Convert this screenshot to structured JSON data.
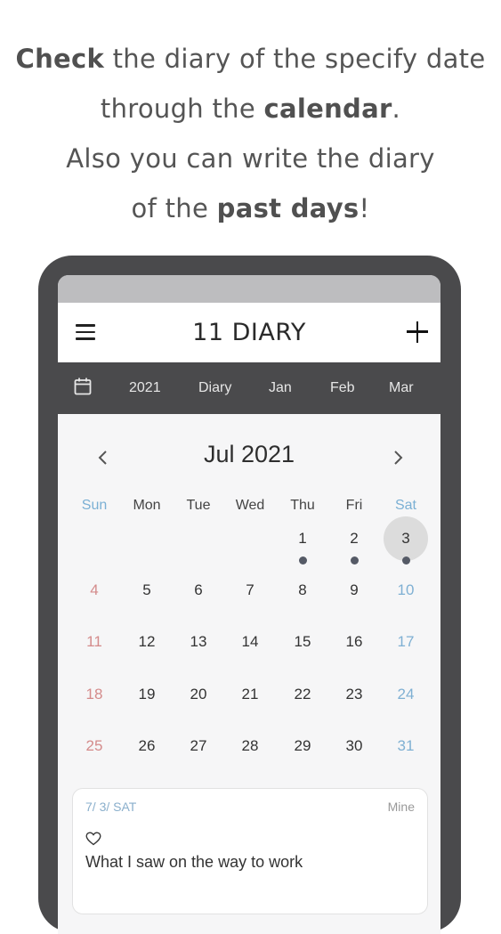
{
  "headline": {
    "line1_bold": "Check",
    "line1_rest": " the diary of the specify date",
    "line2_pre": "through the ",
    "line2_bold": "calendar",
    "line2_post": ".",
    "line3": "Also you can write the diary",
    "line4_pre": "of the ",
    "line4_bold": "past days",
    "line4_post": "!"
  },
  "appbar": {
    "menu_icon": "hamburger-menu-icon",
    "title": "11 DIARY",
    "add_icon": "plus-icon"
  },
  "tabbar": {
    "calendar_icon": "calendar-icon",
    "tabs": [
      "2021",
      "Diary",
      "Jan",
      "Feb",
      "Mar"
    ]
  },
  "calendar": {
    "month_label": "Jul 2021",
    "prev_icon": "chevron-left-icon",
    "next_icon": "chevron-right-icon",
    "weekdays": [
      "Sun",
      "Mon",
      "Tue",
      "Wed",
      "Thu",
      "Fri",
      "Sat"
    ],
    "first_weekday_index": 4,
    "days_in_month": 31,
    "selected_day": 3,
    "days_with_entries": [
      1,
      2,
      3
    ]
  },
  "entry": {
    "date": "7/ 3/ SAT",
    "owner": "Mine",
    "mood_icon": "heart-outline-icon",
    "text": "What I saw on the way to work"
  },
  "colors": {
    "frame": "#4a4a4c",
    "sunday": "#d48b8b",
    "saturday": "#7fb0d3",
    "weekend_header": "#7bb0d4",
    "selected_bg": "#dcdcdc",
    "entry_dot": "#555a66"
  }
}
